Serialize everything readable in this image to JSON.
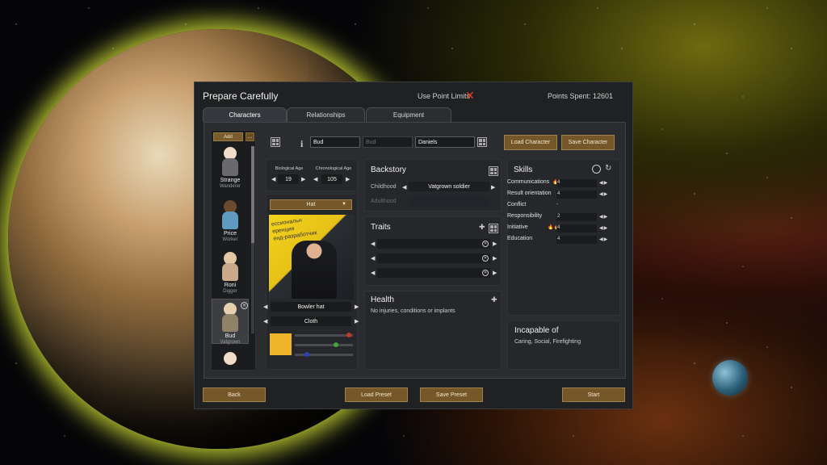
{
  "window": {
    "title": "Prepare Carefully",
    "use_point_limits_label": "Use Point Limits",
    "points_spent": "Points Spent: 12601"
  },
  "tabs": [
    {
      "label": "Characters",
      "active": true
    },
    {
      "label": "Relationships",
      "active": false
    },
    {
      "label": "Equipment",
      "active": false
    }
  ],
  "character_list": {
    "add_label": "Add",
    "add_more_label": "...",
    "characters": [
      {
        "name": "Strange",
        "role": "Wanderer"
      },
      {
        "name": "Price",
        "role": "Worker"
      },
      {
        "name": "Roni",
        "role": "Digger"
      },
      {
        "name": "Bud",
        "role": "Vatgrown",
        "selected": true
      }
    ]
  },
  "name": {
    "first": "Bud",
    "nick_placeholder": "Bud",
    "last": "Daniels"
  },
  "buttons": {
    "load_character": "Load Character",
    "save_character": "Save Character",
    "back": "Back",
    "load_preset": "Load Preset",
    "save_preset": "Save Preset",
    "start": "Start"
  },
  "age": {
    "biological_label": "Biological Age",
    "biological_value": "19",
    "chronological_label": "Chronological Age",
    "chronological_value": "105"
  },
  "apparel": {
    "layer_dropdown": "Hat",
    "item": "Bowler hat",
    "material": "Cloth",
    "color": "#f0b42a"
  },
  "photo": {
    "banner_text": "ессиональн\nеренция\nенд-разработчик"
  },
  "backstory": {
    "title": "Backstory",
    "childhood_label": "Childhood",
    "childhood_value": "Vatgrown soldier",
    "adulthood_label": "Adulthood"
  },
  "traits": {
    "title": "Traits"
  },
  "health": {
    "title": "Health",
    "status": "No injuries, conditions or implants"
  },
  "skills": {
    "title": "Skills",
    "items": [
      {
        "name": "Communications",
        "value": "4",
        "passion": "minor"
      },
      {
        "name": "Result orientation",
        "value": "4",
        "passion": "none"
      },
      {
        "name": "Conflict",
        "value": "-",
        "passion": "none"
      },
      {
        "name": "Responsibility",
        "value": "2",
        "passion": "none"
      },
      {
        "name": "Initiative",
        "value": "4",
        "passion": "major"
      },
      {
        "name": "Education",
        "value": "4",
        "passion": "none"
      }
    ]
  },
  "incapable": {
    "title": "Incapable of",
    "list": "Caring, Social, Firefighting"
  }
}
